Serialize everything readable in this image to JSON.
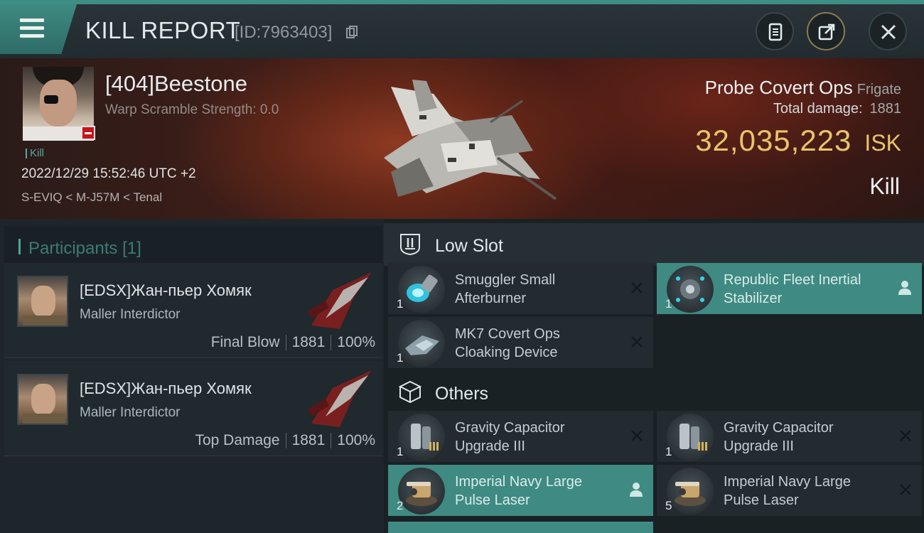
{
  "header": {
    "title": "KILL REPORT",
    "report_id": "[ID:7963403]",
    "buttons": [
      "document-icon",
      "share-icon",
      "close-icon"
    ]
  },
  "victim": {
    "name": "[404]Beestone",
    "warp_scramble": "Warp Scramble Strength: 0.0",
    "tag": "Kill",
    "datetime": "2022/12/29 15:52:46 UTC +2",
    "location": "S-EVIQ < M-J57M < Tenal",
    "ship_name": "Probe Covert Ops",
    "ship_class": "Frigate",
    "total_damage_label": "Total damage:",
    "total_damage": "1881",
    "isk_value": "32,035,223",
    "isk_unit": "ISK",
    "result": "Kill"
  },
  "participants": {
    "title": "Participants",
    "count": "[1]",
    "rows": [
      {
        "name": "[EDSX]Жан-пьер Хомяк",
        "ship": "Maller Interdictor",
        "label": "Final Blow",
        "damage": "1881",
        "percent": "100%"
      },
      {
        "name": "[EDSX]Жан-пьер Хомяк",
        "ship": "Maller Interdictor",
        "label": "Top Damage",
        "damage": "1881",
        "percent": "100%"
      }
    ]
  },
  "sections": {
    "low_slot": {
      "title": "Low Slot",
      "items": [
        {
          "name": "Smuggler Small Afterburner",
          "qty": "1",
          "status": "destroyed"
        },
        {
          "name": "Republic Fleet Inertial Stabilizer",
          "qty": "1",
          "status": "dropped"
        },
        {
          "name": "MK7 Covert Ops Cloaking Device",
          "qty": "1",
          "status": "destroyed"
        }
      ]
    },
    "others": {
      "title": "Others",
      "items": [
        {
          "name": "Gravity Capacitor Upgrade III",
          "qty": "1",
          "status": "destroyed"
        },
        {
          "name": "Gravity Capacitor Upgrade III",
          "qty": "1",
          "status": "destroyed"
        },
        {
          "name": "Imperial Navy Large Pulse Laser",
          "qty": "2",
          "status": "dropped"
        },
        {
          "name": "Imperial Navy Large Pulse Laser",
          "qty": "5",
          "status": "destroyed"
        }
      ]
    }
  },
  "colors": {
    "accent": "#3f8a82",
    "isk": "#e9c46a",
    "loss_badge": "#c8141a"
  }
}
